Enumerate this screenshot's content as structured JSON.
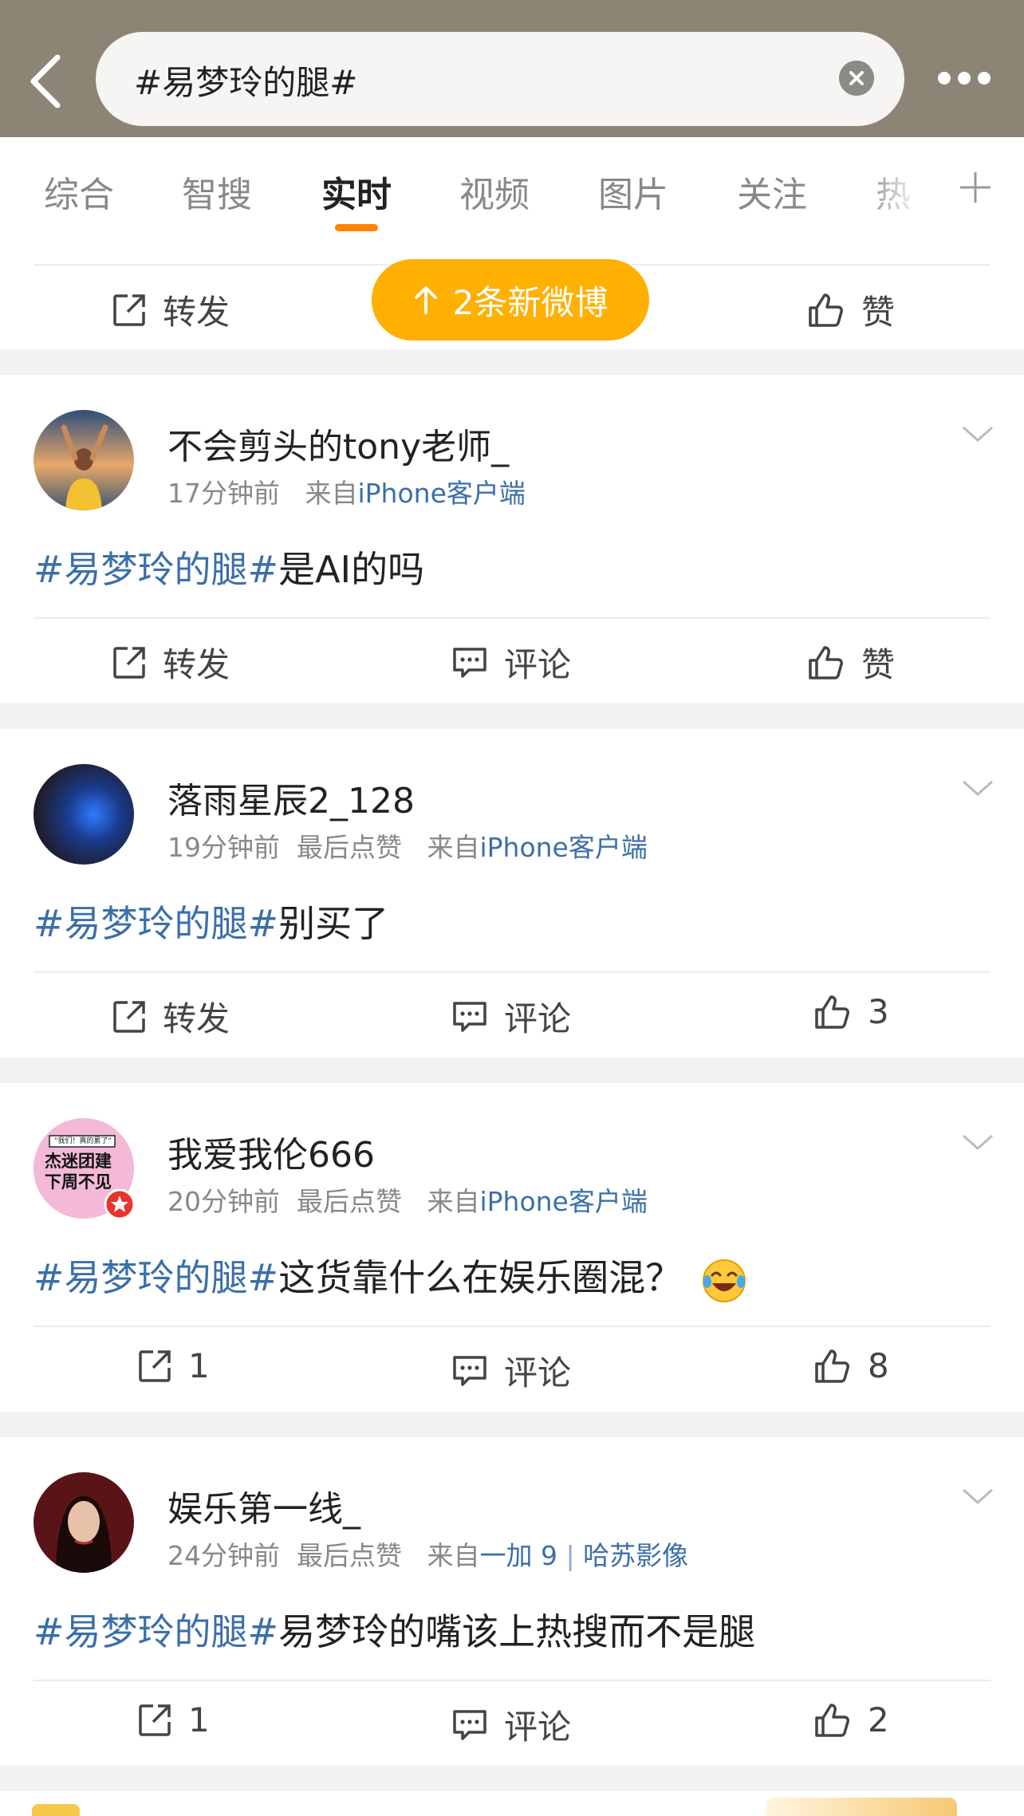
{
  "header": {
    "search_text": "#易梦玲的腿#"
  },
  "tabs": [
    {
      "label": "综合"
    },
    {
      "label": "智搜"
    },
    {
      "label": "实时"
    },
    {
      "label": "视频"
    },
    {
      "label": "图片"
    },
    {
      "label": "关注"
    },
    {
      "label": "热"
    }
  ],
  "top_actions": {
    "repost": "转发",
    "like": "赞"
  },
  "new_posts_pill": "2条新微博",
  "posts": [
    {
      "username": "不会剪头的tony老师_",
      "time": "17分钟前",
      "extra": "",
      "from_label": "来自",
      "source": "iPhone客户端",
      "hashtag": "#易梦玲的腿#",
      "text": "是AI的吗",
      "repost": "转发",
      "comment": "评论",
      "like": "赞"
    },
    {
      "username": "落雨星辰2_128",
      "time": "19分钟前",
      "extra": "最后点赞",
      "from_label": "来自",
      "source": "iPhone客户端",
      "hashtag": "#易梦玲的腿#",
      "text": "别买了",
      "repost": "转发",
      "comment": "评论",
      "like": "3"
    },
    {
      "username": "我爱我伦666",
      "time": "20分钟前",
      "extra": "最后点赞",
      "from_label": "来自",
      "source": "iPhone客户端",
      "hashtag": "#易梦玲的腿#",
      "text": "这货靠什么在娱乐圈混？",
      "avatar_text_1": "\"我们！真的累了\"",
      "avatar_text_2": "杰迷团建",
      "avatar_text_3": "下周不见",
      "repost": "1",
      "comment": "评论",
      "like": "8"
    },
    {
      "username": "娱乐第一线_",
      "time": "24分钟前",
      "extra": "最后点赞",
      "from_label": "来自",
      "source": "一加 9",
      "source2": "哈苏影像",
      "hashtag": "#易梦玲的腿#",
      "text": "易梦玲的嘴该上热搜而不是腿",
      "repost": "1",
      "comment": "评论",
      "like": "2"
    }
  ],
  "colors": {
    "accent": "#ff8200",
    "link": "#3b6fa8",
    "pill": "#ffb000"
  }
}
